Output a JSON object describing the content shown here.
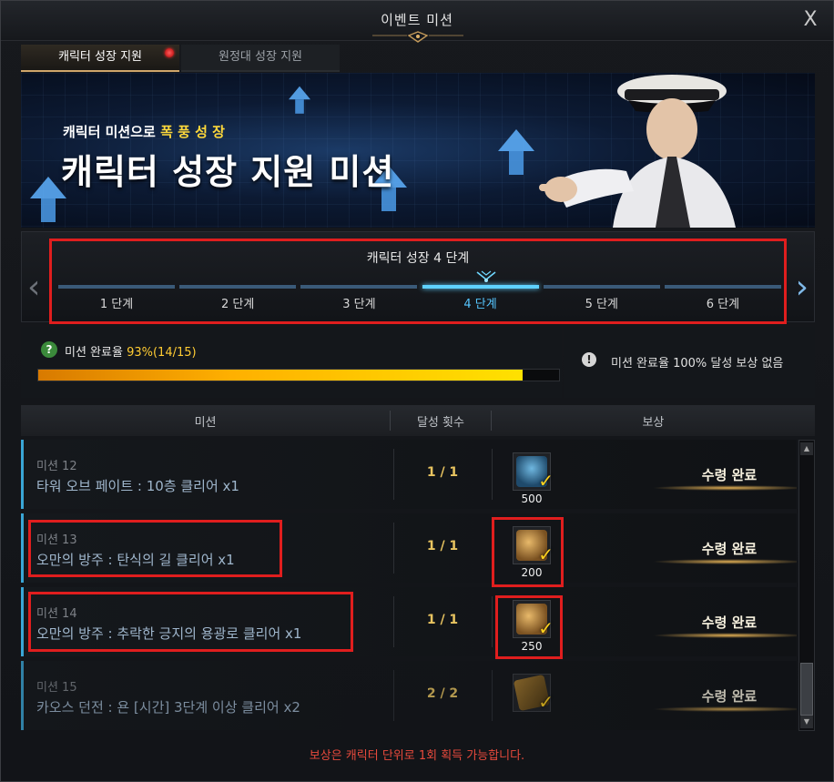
{
  "window": {
    "title": "이벤트 미션",
    "close_label": "X"
  },
  "tabs": [
    {
      "label": "캐릭터 성장 지원",
      "active": true,
      "badge": true
    },
    {
      "label": "원정대 성장 지원",
      "active": false
    }
  ],
  "banner": {
    "subtitle_prefix": "캐릭터 미션으로",
    "subtitle_highlight": "폭 풍 성 장",
    "title": "캐릭터 성장 지원 미션"
  },
  "stages": {
    "title": "캐릭터 성장 4 단계",
    "items": [
      "1 단계",
      "2 단계",
      "3 단계",
      "4 단계",
      "5 단계",
      "6 단계"
    ],
    "current_index": 3
  },
  "completion": {
    "label": "미션 완료율",
    "value": "93%(14/15)",
    "progress": 0.93,
    "reward_note": "미션 완료율 100% 달성 보상 없음"
  },
  "table": {
    "headers": [
      "미션",
      "달성 횟수",
      "보상"
    ],
    "rows": [
      {
        "number": "미션 12",
        "name": "타워 오브 페이트 : 10층 클리어 x1",
        "count": "1 / 1",
        "reward_qty": "500",
        "reward_icon": "crystal-icon",
        "status": "수령 완료"
      },
      {
        "number": "미션 13",
        "name": "오만의 방주 : 탄식의 길 클리어 x1",
        "count": "1 / 1",
        "reward_qty": "200",
        "reward_icon": "coin-icon",
        "status": "수령 완료"
      },
      {
        "number": "미션 14",
        "name": "오만의 방주 : 추락한 긍지의 용광로 클리어 x1",
        "count": "1 / 1",
        "reward_qty": "250",
        "reward_icon": "coin-icon",
        "status": "수령 완료"
      },
      {
        "number": "미션 15",
        "name": "카오스 던전 : 욘 [시간] 3단계 이상 클리어 x2",
        "count": "2 / 2",
        "reward_qty": "",
        "reward_icon": "ticket-icon",
        "status": "수령 완료"
      }
    ]
  },
  "footer": "보상은 캐릭터 단위로 1회 획득 가능합니다.",
  "colors": {
    "accent": "#56c6ff",
    "gold": "#ffcc33",
    "highlight": "#e01e1e",
    "footer": "#e84a3c"
  }
}
